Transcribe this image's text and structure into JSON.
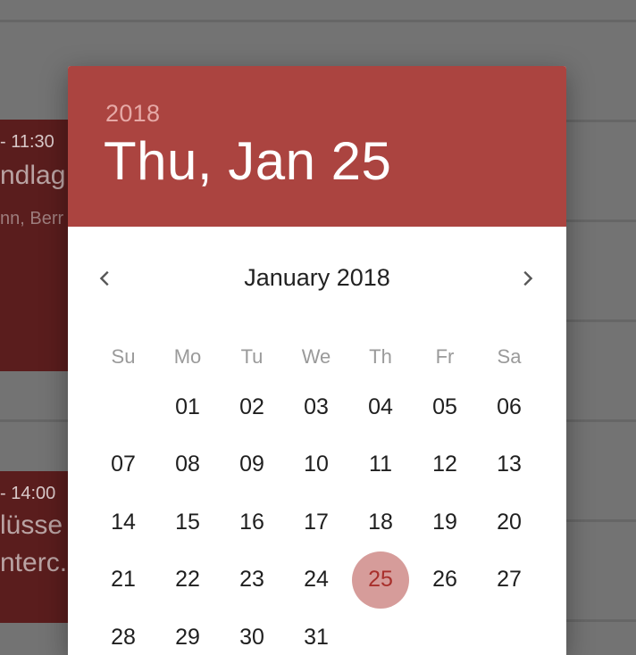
{
  "background": {
    "events": [
      {
        "time": "- 11:30",
        "title": "ndlag",
        "subtitle": "nn, Berr"
      },
      {
        "time": "- 14:00",
        "title": "lüsse",
        "subtitle": "nterc."
      }
    ]
  },
  "date_picker": {
    "header": {
      "year": "2018",
      "selected_date": "Thu, Jan 25"
    },
    "month_label": "January 2018",
    "weekdays": [
      "Su",
      "Mo",
      "Tu",
      "We",
      "Th",
      "Fr",
      "Sa"
    ],
    "days": [
      "01",
      "02",
      "03",
      "04",
      "05",
      "06",
      "07",
      "08",
      "09",
      "10",
      "11",
      "12",
      "13",
      "14",
      "15",
      "16",
      "17",
      "18",
      "19",
      "20",
      "21",
      "22",
      "23",
      "24",
      "25",
      "26",
      "27",
      "28",
      "29",
      "30",
      "31"
    ],
    "first_weekday_index": 1,
    "selected_day": "25",
    "colors": {
      "header": "#ab4440",
      "selected_circle": "#d69c9a",
      "selected_text": "#a8302c"
    }
  }
}
